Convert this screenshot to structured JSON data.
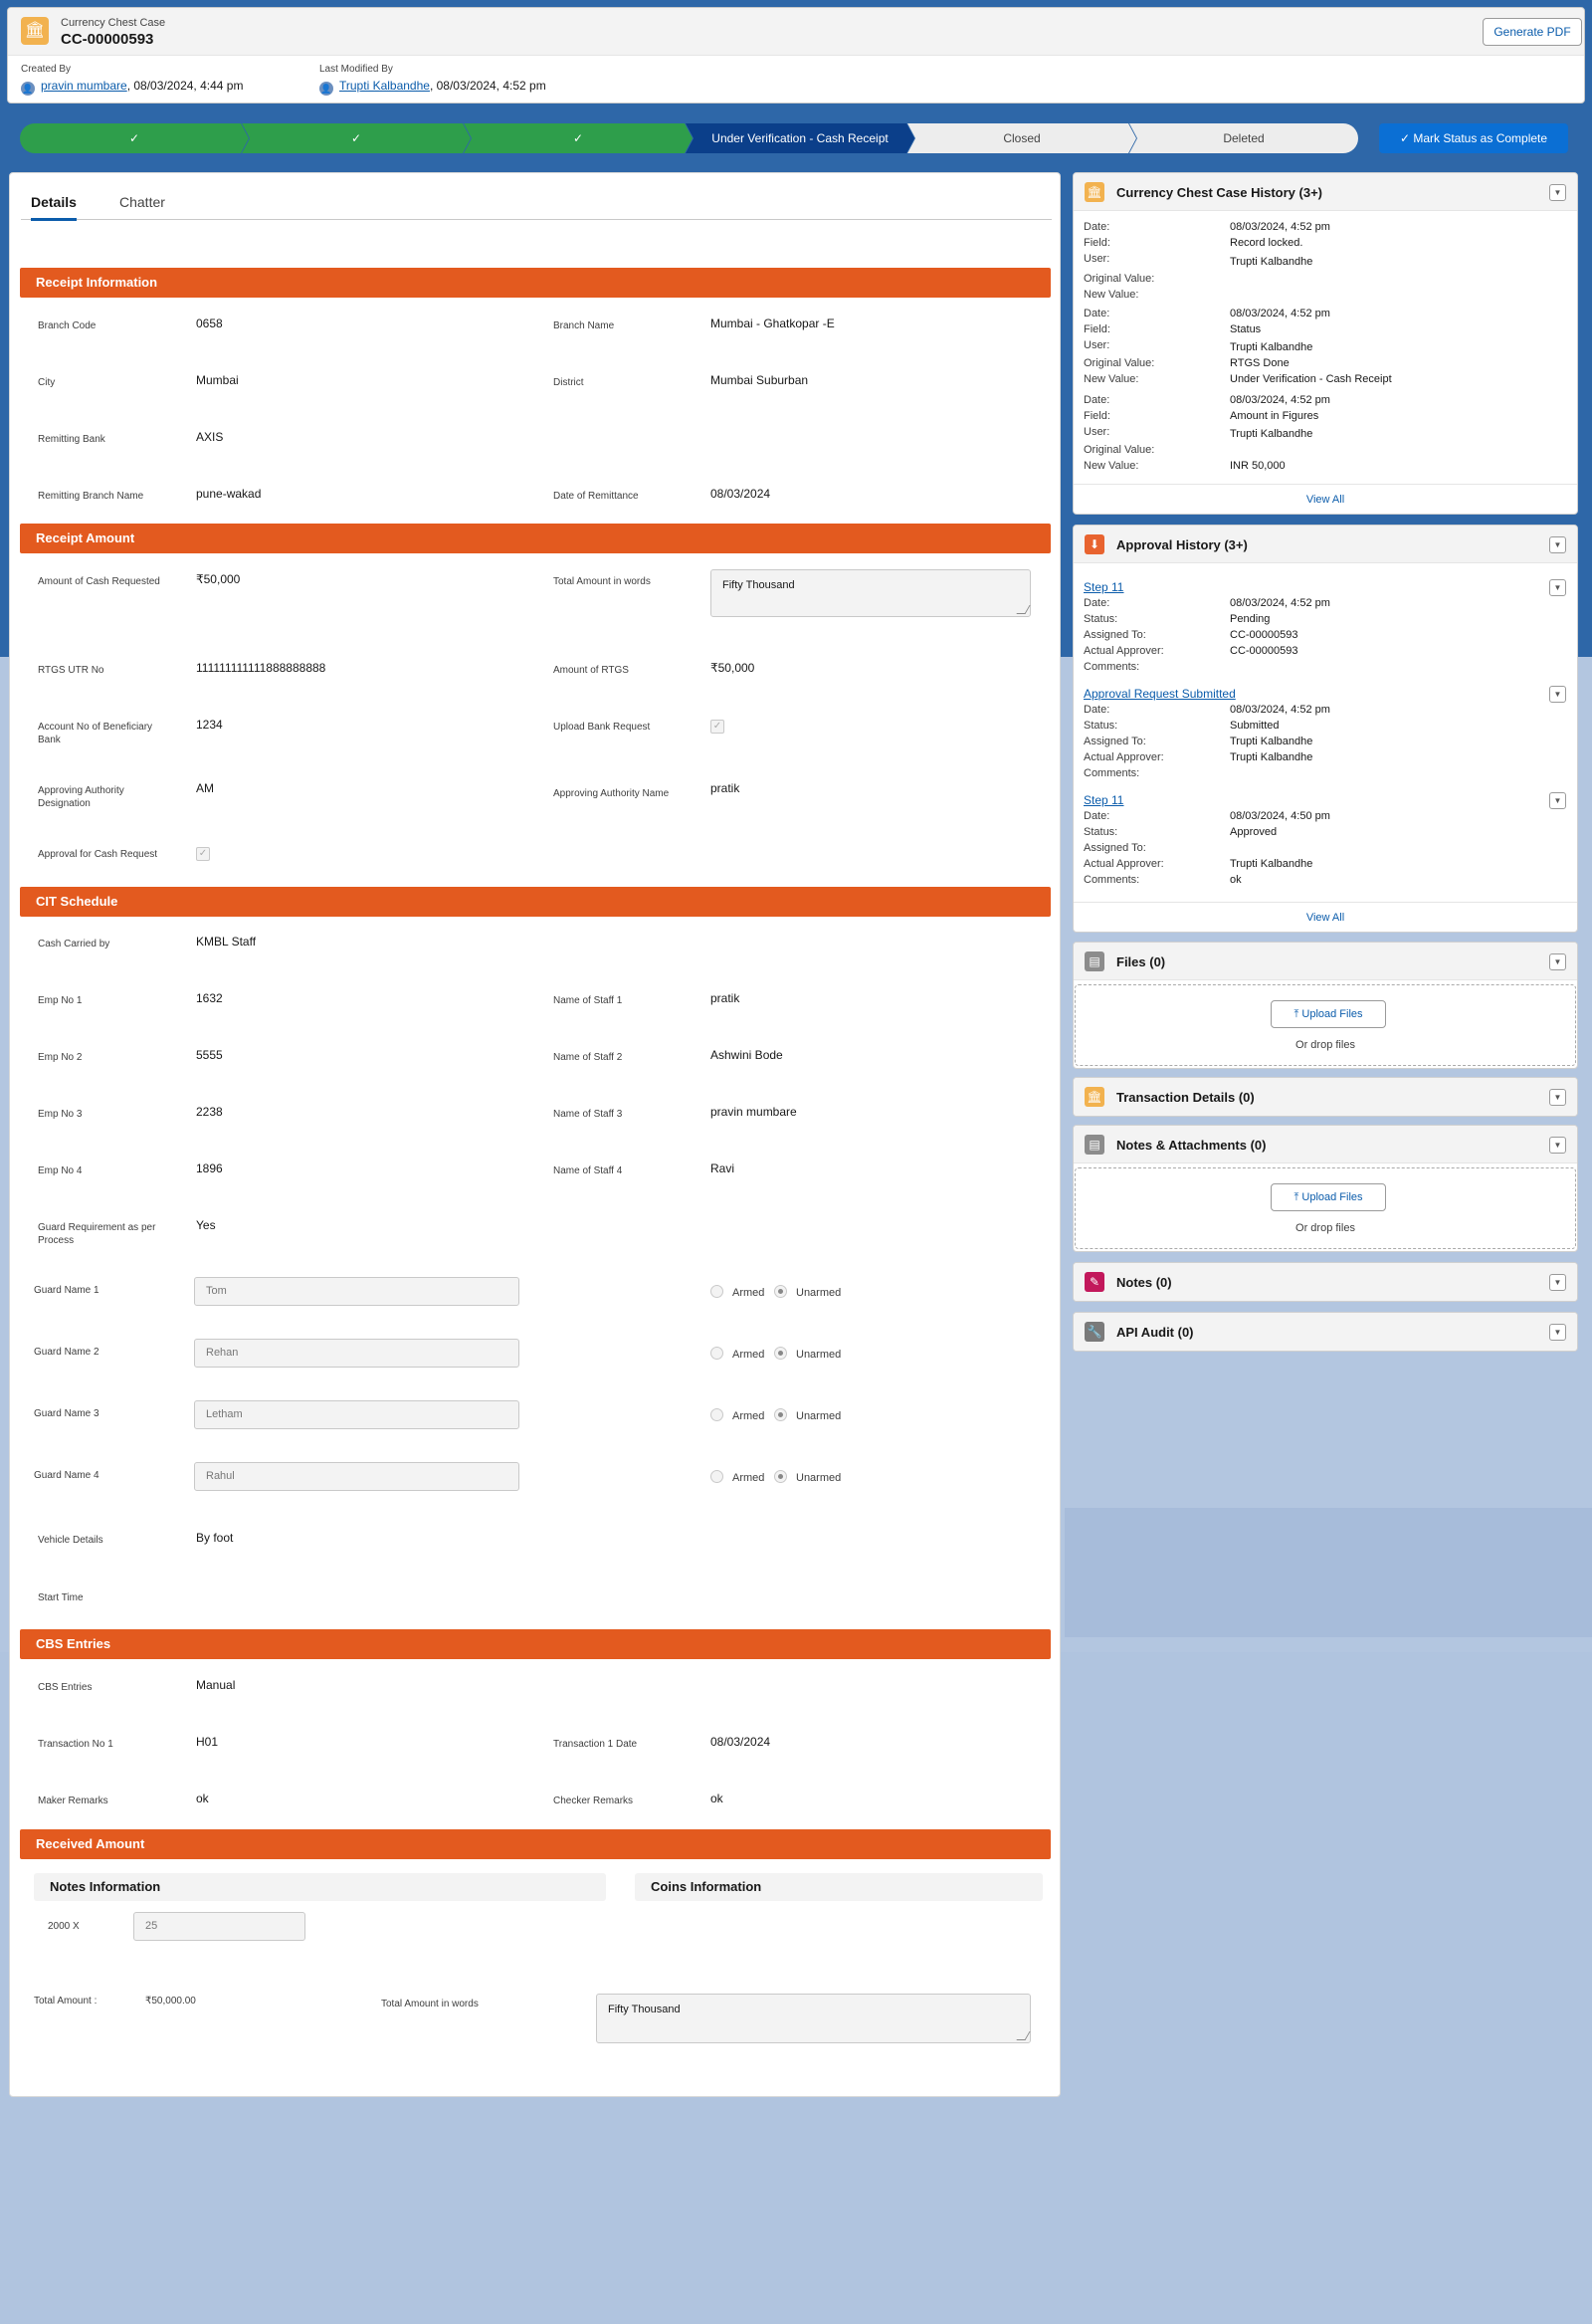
{
  "header": {
    "object_type": "Currency Chest Case",
    "record_name": "CC-00000593",
    "generate_pdf": "Generate PDF",
    "created_by_label": "Created By",
    "created_by_user": "pravin mumbare",
    "created_by_date": ", 08/03/2024, 4:44 pm",
    "modified_by_label": "Last Modified By",
    "modified_by_user": "Trupti Kalbandhe",
    "modified_by_date": ", 08/03/2024, 4:52 pm"
  },
  "path": {
    "steps": [
      {
        "label": "✓",
        "state": "complete"
      },
      {
        "label": "✓",
        "state": "complete"
      },
      {
        "label": "✓",
        "state": "complete"
      },
      {
        "label": "Under Verification - Cash Receipt",
        "state": "current"
      },
      {
        "label": "Closed",
        "state": "incomplete"
      },
      {
        "label": "Deleted",
        "state": "incomplete"
      }
    ],
    "mark_complete": "✓ Mark Status as Complete"
  },
  "tabs": [
    "Details",
    "Chatter"
  ],
  "receipt_info": {
    "title": "Receipt Information",
    "branch_code_label": "Branch Code",
    "branch_code": "0658",
    "branch_name_label": "Branch Name",
    "branch_name": "Mumbai - Ghatkopar -E",
    "city_label": "City",
    "city": "Mumbai",
    "district_label": "District",
    "district": "Mumbai Suburban",
    "remitting_bank_label": "Remitting Bank",
    "remitting_bank": "AXIS",
    "remitting_branch_label": "Remitting Branch Name",
    "remitting_branch": "pune-wakad",
    "date_remit_label": "Date of Remittance",
    "date_remit": "08/03/2024"
  },
  "receipt_amount": {
    "title": "Receipt Amount",
    "cash_req_label": "Amount of Cash Requested",
    "cash_req": "₹50,000",
    "total_words_label": "Total Amount in words",
    "total_words": "Fifty  Thousand",
    "rtgs_utr_label": "RTGS UTR No",
    "rtgs_utr": "111111111111888888888",
    "amount_rtgs_label": "Amount of RTGS",
    "amount_rtgs": "₹50,000",
    "account_no_label": "Account No of Beneficiary Bank",
    "account_no": "1234",
    "upload_bank_label": "Upload Bank Request",
    "approving_desig_label": "Approving Authority Designation",
    "approving_desig": "AM",
    "approving_name_label": "Approving Authority Name",
    "approving_name": "pratik",
    "approval_cash_label": "Approval for Cash Request"
  },
  "cit": {
    "title": "CIT Schedule",
    "cash_carried_label": "Cash Carried by",
    "cash_carried": "KMBL Staff",
    "staff": [
      {
        "emp_label": "Emp No 1",
        "emp": "1632",
        "name_label": "Name of Staff 1",
        "name": "pratik"
      },
      {
        "emp_label": "Emp No 2",
        "emp": "5555",
        "name_label": "Name of Staff 2",
        "name": "Ashwini Bode"
      },
      {
        "emp_label": "Emp No 3",
        "emp": "2238",
        "name_label": "Name of Staff 3",
        "name": "pravin mumbare"
      },
      {
        "emp_label": "Emp No 4",
        "emp": "1896",
        "name_label": "Name of Staff 4",
        "name": "Ravi"
      }
    ],
    "guard_req_label": "Guard Requirement as per Process",
    "guard_req": "Yes",
    "guards": [
      {
        "label": "Guard Name 1",
        "value": "Tom"
      },
      {
        "label": "Guard Name 2",
        "value": "Rehan"
      },
      {
        "label": "Guard Name 3",
        "value": "Letham"
      },
      {
        "label": "Guard Name 4",
        "value": "Rahul"
      }
    ],
    "armed": "Armed",
    "unarmed": "Unarmed",
    "vehicle_label": "Vehicle Details",
    "vehicle": "By foot",
    "start_time_label": "Start Time"
  },
  "cbs": {
    "title": "CBS Entries",
    "cbs_label": "CBS Entries",
    "cbs": "Manual",
    "txn1_label": "Transaction No 1",
    "txn1": "H01",
    "txn1_date_label": "Transaction 1 Date",
    "txn1_date": "08/03/2024",
    "maker_label": "Maker Remarks",
    "maker": "ok",
    "checker_label": "Checker Remarks",
    "checker": "ok"
  },
  "received": {
    "title": "Received Amount",
    "notes_info": "Notes Information",
    "coins_info": "Coins Information",
    "denom_label": "2000 X",
    "denom_value": "25",
    "total_label": "Total Amount :",
    "total": "₹50,000.00",
    "total_words_label": "Total Amount in words",
    "total_words": "Fifty  Thousand"
  },
  "history": {
    "title": "Currency Chest Case History (3+)",
    "entries": [
      {
        "date": "08/03/2024, 4:52 pm",
        "field": "Record locked.",
        "user": "Trupti Kalbandhe",
        "orig": "",
        "new": ""
      },
      {
        "date": "08/03/2024, 4:52 pm",
        "field": "Status",
        "user": "Trupti Kalbandhe",
        "orig": "RTGS Done",
        "new": "Under Verification - Cash Receipt"
      },
      {
        "date": "08/03/2024, 4:52 pm",
        "field": "Amount in Figures",
        "user": "Trupti Kalbandhe",
        "orig": "",
        "new": "INR 50,000"
      }
    ],
    "labels": {
      "date": "Date:",
      "field": "Field:",
      "user": "User:",
      "orig": "Original Value:",
      "new": "New Value:"
    },
    "view_all": "View All"
  },
  "approval": {
    "title": "Approval History (3+)",
    "entries": [
      {
        "step": "Step 11",
        "date": "08/03/2024, 4:52 pm",
        "status": "Pending",
        "assigned": "CC-00000593",
        "actual": "CC-00000593",
        "comments": ""
      },
      {
        "step": "Approval Request Submitted",
        "date": "08/03/2024, 4:52 pm",
        "status": "Submitted",
        "assigned": "Trupti Kalbandhe",
        "actual": "Trupti Kalbandhe",
        "comments": ""
      },
      {
        "step": "Step 11",
        "date": "08/03/2024, 4:50 pm",
        "status": "Approved",
        "assigned": "",
        "actual": "Trupti Kalbandhe",
        "comments": "ok"
      }
    ],
    "labels": {
      "date": "Date:",
      "status": "Status:",
      "assigned": "Assigned To:",
      "actual": "Actual Approver:",
      "comments": "Comments:"
    },
    "view_all": "View All"
  },
  "files": {
    "title": "Files (0)",
    "upload": "Upload Files",
    "drop": "Or drop files"
  },
  "transaction_details": {
    "title": "Transaction Details (0)"
  },
  "notes_attach": {
    "title": "Notes & Attachments (0)",
    "upload": "Upload Files",
    "drop": "Or drop files"
  },
  "notes": {
    "title": "Notes (0)"
  },
  "api_audit": {
    "title": "API Audit (0)"
  },
  "colors": {
    "accent": "#e35a1f",
    "brand": "#0b6fd4",
    "path_complete": "#2e9e4b",
    "path_current": "#0b3f8a"
  }
}
